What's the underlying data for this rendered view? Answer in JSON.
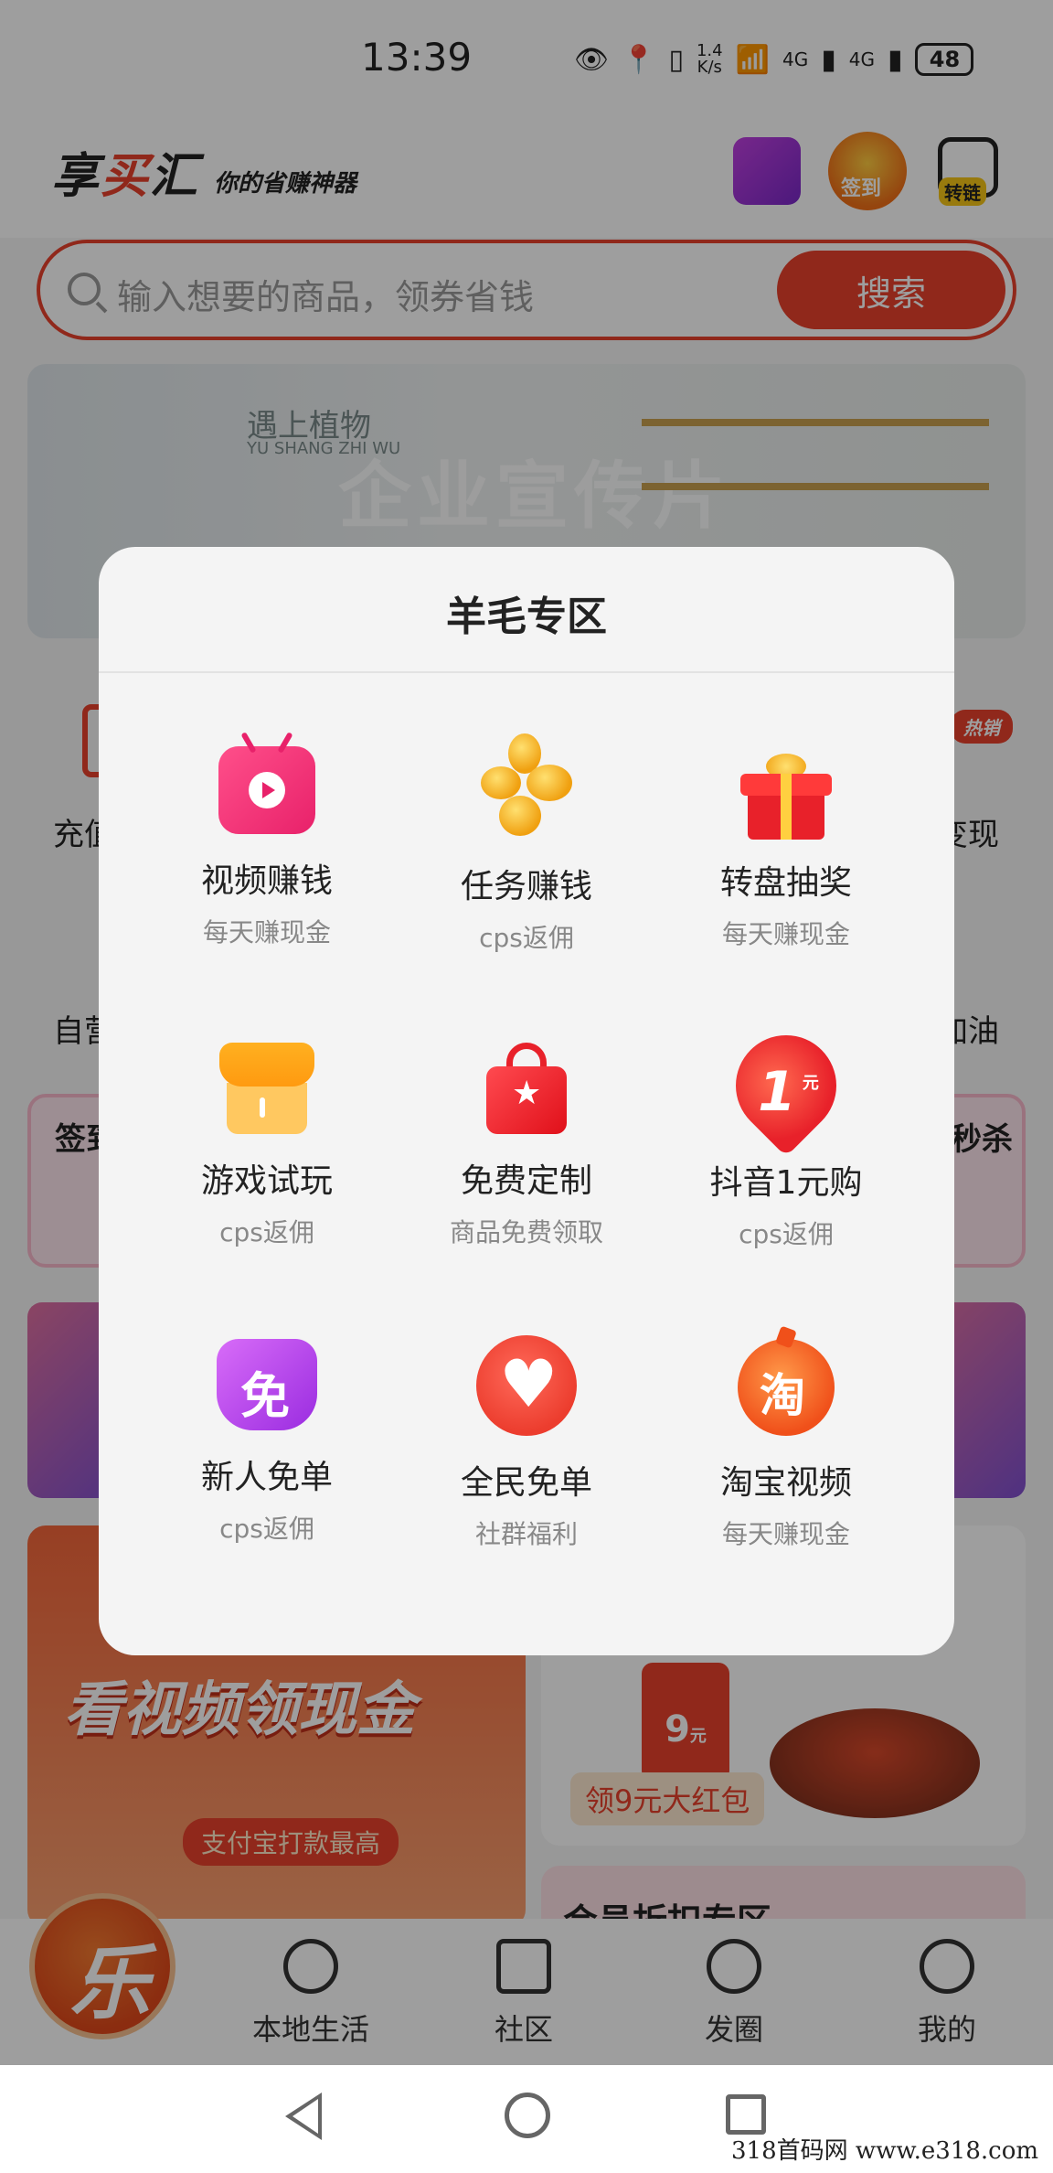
{
  "status_bar": {
    "time": "13:39",
    "net_speed_value": "1.4",
    "net_speed_unit": "K/s",
    "signal_1": "4G",
    "signal_2": "4G",
    "battery": "48"
  },
  "header": {
    "logo_main": "享",
    "logo_red": "买",
    "logo_end": "汇",
    "slogan": "你的省赚神器",
    "checkin_label": "签到",
    "convert_label": "转链"
  },
  "search": {
    "placeholder": "输入想要的商品，领券省钱",
    "button": "搜索"
  },
  "banner": {
    "brand_cn": "遇上植物",
    "brand_en": "YU SHANG ZHI WU",
    "title": "企业宣传片"
  },
  "background_snippets": {
    "left_1": "充值",
    "right_1": "变现",
    "left_2": "自营",
    "right_2": "加油",
    "hot_badge": "热销",
    "left_card": "签到",
    "right_card": "秒杀",
    "promo_title": "看视频领现金",
    "promo_tag": "支付宝打款最高",
    "redpack_value": "9",
    "redpack_unit": "元",
    "redpack_label": "领9元大红包",
    "member_title": "会员折扣专区"
  },
  "modal": {
    "title": "羊毛专区",
    "items": [
      {
        "title": "视频赚钱",
        "subtitle": "每天赚现金",
        "icon": "video-tv-icon"
      },
      {
        "title": "任务赚钱",
        "subtitle": "cps返佣",
        "icon": "gold-coins-icon"
      },
      {
        "title": "转盘抽奖",
        "subtitle": "每天赚现金",
        "icon": "gift-box-icon"
      },
      {
        "title": "游戏试玩",
        "subtitle": "cps返佣",
        "icon": "shop-store-icon"
      },
      {
        "title": "免费定制",
        "subtitle": "商品免费领取",
        "icon": "shopping-bag-icon"
      },
      {
        "title": "抖音1元购",
        "subtitle": "cps返佣",
        "icon": "one-yuan-icon",
        "icon_text": "1",
        "icon_unit": "元"
      },
      {
        "title": "新人免单",
        "subtitle": "cps返佣",
        "icon": "free-coupon-icon",
        "icon_text": "免"
      },
      {
        "title": "全民免单",
        "subtitle": "社群福利",
        "icon": "heart-icon"
      },
      {
        "title": "淘宝视频",
        "subtitle": "每天赚现金",
        "icon": "taobao-icon",
        "icon_text": "淘"
      }
    ]
  },
  "tabbar": {
    "center_logo": "乐",
    "tabs": [
      {
        "label": "本地生活",
        "icon": "flame-icon"
      },
      {
        "label": "社区",
        "icon": "graduation-cap-icon"
      },
      {
        "label": "发圈",
        "icon": "moments-icon"
      },
      {
        "label": "我的",
        "icon": "user-icon"
      }
    ]
  },
  "watermark": "318首码网  www.e318.com",
  "colors": {
    "accent": "#e8412c",
    "modal_bg": "#f4f4f4",
    "overlay": "rgba(0,0,0,0.38)"
  }
}
